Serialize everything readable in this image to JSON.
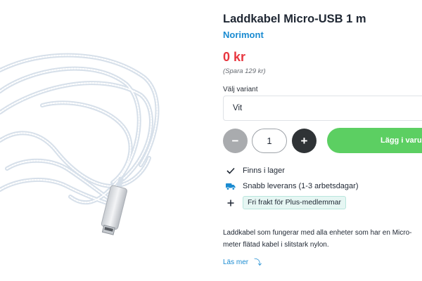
{
  "product": {
    "title": "Laddkabel Micro-USB 1 m",
    "brand": "Norimont",
    "price": "0 kr",
    "savings": "(Spara 129 kr)",
    "image_icon": "braided-white-micro-usb-cable"
  },
  "variant": {
    "label": "Välj variant",
    "selected": "Vit"
  },
  "quantity": {
    "minus_label": "−",
    "value": "1",
    "plus_label": "+"
  },
  "cart": {
    "add_label": "Lägg i varuk"
  },
  "features": [
    {
      "icon": "check-icon",
      "text": "Finns i lager"
    },
    {
      "icon": "delivery-truck-icon",
      "text": "Snabb leverans (1-3 arbetsdagar)"
    },
    {
      "icon": "plus-icon",
      "text": "Fri frakt för Plus-medlemmar"
    }
  ],
  "description": {
    "line1": "Laddkabel som fungerar med alla enheter som har en Micro-",
    "line2": "meter flätad kabel i slitstark nylon."
  },
  "read_more": {
    "label": "Läs mer",
    "icon": "arrow-down-icon"
  },
  "colors": {
    "price": "#e8363f",
    "brand_link": "#1a8bd1",
    "add_to_cart": "#5ccf62",
    "qty_minus": "#a9abae",
    "qty_plus": "#2f3336",
    "plus_badge_bg": "#e6f6f3",
    "truck_icon": "#1a8bd1"
  }
}
